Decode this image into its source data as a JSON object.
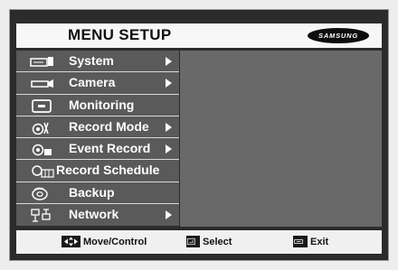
{
  "title": "MENU SETUP",
  "brand": "SAMSUNG",
  "menu_items": [
    {
      "label": "System",
      "icon": "system-icon",
      "has_submenu": true
    },
    {
      "label": "Camera",
      "icon": "camera-icon",
      "has_submenu": true
    },
    {
      "label": "Monitoring",
      "icon": "monitor-icon",
      "has_submenu": false
    },
    {
      "label": "Record Mode",
      "icon": "record-mode-icon",
      "has_submenu": true
    },
    {
      "label": "Event Record",
      "icon": "event-record-icon",
      "has_submenu": true
    },
    {
      "label": "Record Schedule",
      "icon": "record-schedule-icon",
      "has_submenu": false
    },
    {
      "label": "Backup",
      "icon": "backup-disc-icon",
      "has_submenu": false
    },
    {
      "label": "Network",
      "icon": "network-icon",
      "has_submenu": true
    }
  ],
  "footer": {
    "move": "Move/Control",
    "select": "Select",
    "exit": "Exit"
  },
  "colors": {
    "menu_bg": "#5a5a5a",
    "pane_bg": "#696969",
    "frame_bg": "#2b2b2b"
  }
}
